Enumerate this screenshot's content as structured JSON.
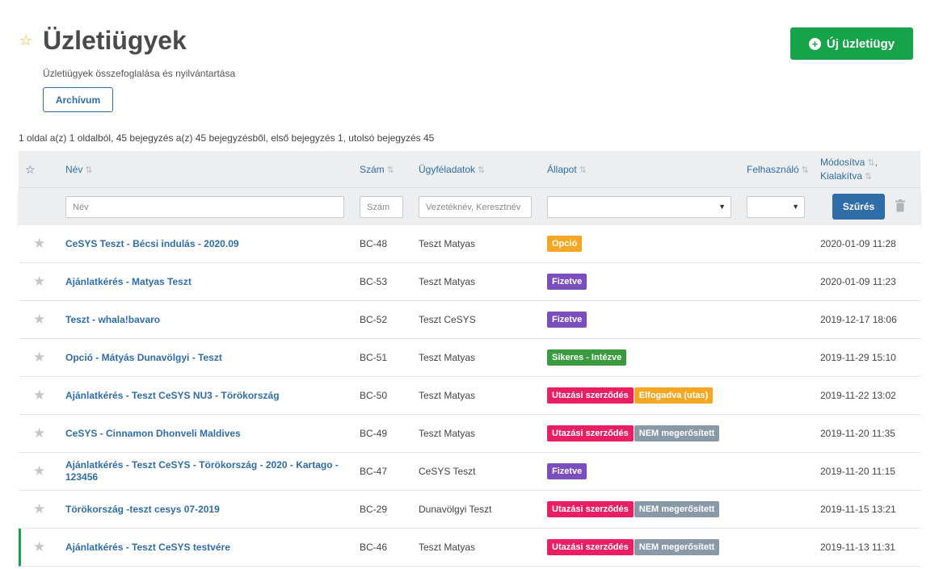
{
  "header": {
    "title": "Üzletiügyek",
    "subtitle": "Üzletiügyek összefoglalása és nyilvántartása",
    "archive_label": "Archívum",
    "new_label": "Új üzletiügy"
  },
  "pager_text": "1 oldal a(z) 1 oldalból, 45 bejegyzés a(z) 45 bejegyzésből, első bejegyzés 1, utolsó bejegyzés 45",
  "columns": {
    "name": "Név",
    "number": "Szám",
    "client": "Ügyféladatok",
    "status": "Állapot",
    "user": "Felhasználó",
    "modified": "Módosítva",
    "created": "Kialakítva"
  },
  "filters": {
    "name_placeholder": "Név",
    "number_placeholder": "Szám",
    "client_placeholder": "Vezetéknév, Keresztnév",
    "filter_label": "Szűrés"
  },
  "colors": {
    "accent": "#2f6da8",
    "primary_green": "#16a34a",
    "badge_orange": "#f5a623",
    "badge_purple": "#7a4fbd",
    "badge_green": "#3a9a3e",
    "badge_pink": "#e91e63",
    "badge_gray": "#8a99a8"
  },
  "rows": [
    {
      "name": "CeSYS Teszt - Bécsi indulás - 2020.09",
      "number": "BC-48",
      "client": "Teszt Matyas",
      "badges": [
        {
          "text": "Opció",
          "color": "orange"
        }
      ],
      "modified": "2020-01-09 11:28",
      "marked": false
    },
    {
      "name": "Ajánlatkérés - Matyas Teszt",
      "number": "BC-53",
      "client": "Teszt Matyas",
      "badges": [
        {
          "text": "Fizetve",
          "color": "purple"
        }
      ],
      "modified": "2020-01-09 11:23",
      "marked": false
    },
    {
      "name": "Teszt - whala!bavaro",
      "number": "BC-52",
      "client": "Teszt CeSYS",
      "badges": [
        {
          "text": "Fizetve",
          "color": "purple"
        }
      ],
      "modified": "2019-12-17 18:06",
      "marked": false
    },
    {
      "name": "Opció - Mátyás Dunavölgyi - Teszt",
      "number": "BC-51",
      "client": "Teszt Matyas",
      "badges": [
        {
          "text": "Sikeres - Intézve",
          "color": "green"
        }
      ],
      "modified": "2019-11-29 15:10",
      "marked": false
    },
    {
      "name": "Ajánlatkérés - Teszt CeSYS NU3 - Törökország",
      "number": "BC-50",
      "client": "Teszt Matyas",
      "badges": [
        {
          "text": "Utazási szerződés",
          "color": "pink"
        },
        {
          "text": "Elfogadva (utas)",
          "color": "orange"
        }
      ],
      "modified": "2019-11-22 13:02",
      "marked": false
    },
    {
      "name": "CeSYS - Cinnamon Dhonveli Maldives",
      "number": "BC-49",
      "client": "Teszt Matyas",
      "badges": [
        {
          "text": "Utazási szerződés",
          "color": "pink"
        },
        {
          "text": "NEM megerősített",
          "color": "gray"
        }
      ],
      "modified": "2019-11-20 11:35",
      "marked": false
    },
    {
      "name": "Ajánlatkérés - Teszt CeSYS - Törökország - 2020 - Kartago - 123456",
      "number": "BC-47",
      "client": "CeSYS Teszt",
      "badges": [
        {
          "text": "Fizetve",
          "color": "purple"
        }
      ],
      "modified": "2019-11-20 11:15",
      "marked": false
    },
    {
      "name": "Törökország -teszt cesys 07-2019",
      "number": "BC-29",
      "client": "Dunavölgyi Teszt",
      "badges": [
        {
          "text": "Utazási szerződés",
          "color": "pink"
        },
        {
          "text": "NEM megerősített",
          "color": "gray"
        }
      ],
      "modified": "2019-11-15 13:21",
      "marked": false
    },
    {
      "name": "Ajánlatkérés - Teszt CeSYS testvére",
      "number": "BC-46",
      "client": "Teszt Matyas",
      "badges": [
        {
          "text": "Utazási szerződés",
          "color": "pink"
        },
        {
          "text": "NEM megerősített",
          "color": "gray"
        }
      ],
      "modified": "2019-11-13 11:31",
      "marked": true
    }
  ]
}
